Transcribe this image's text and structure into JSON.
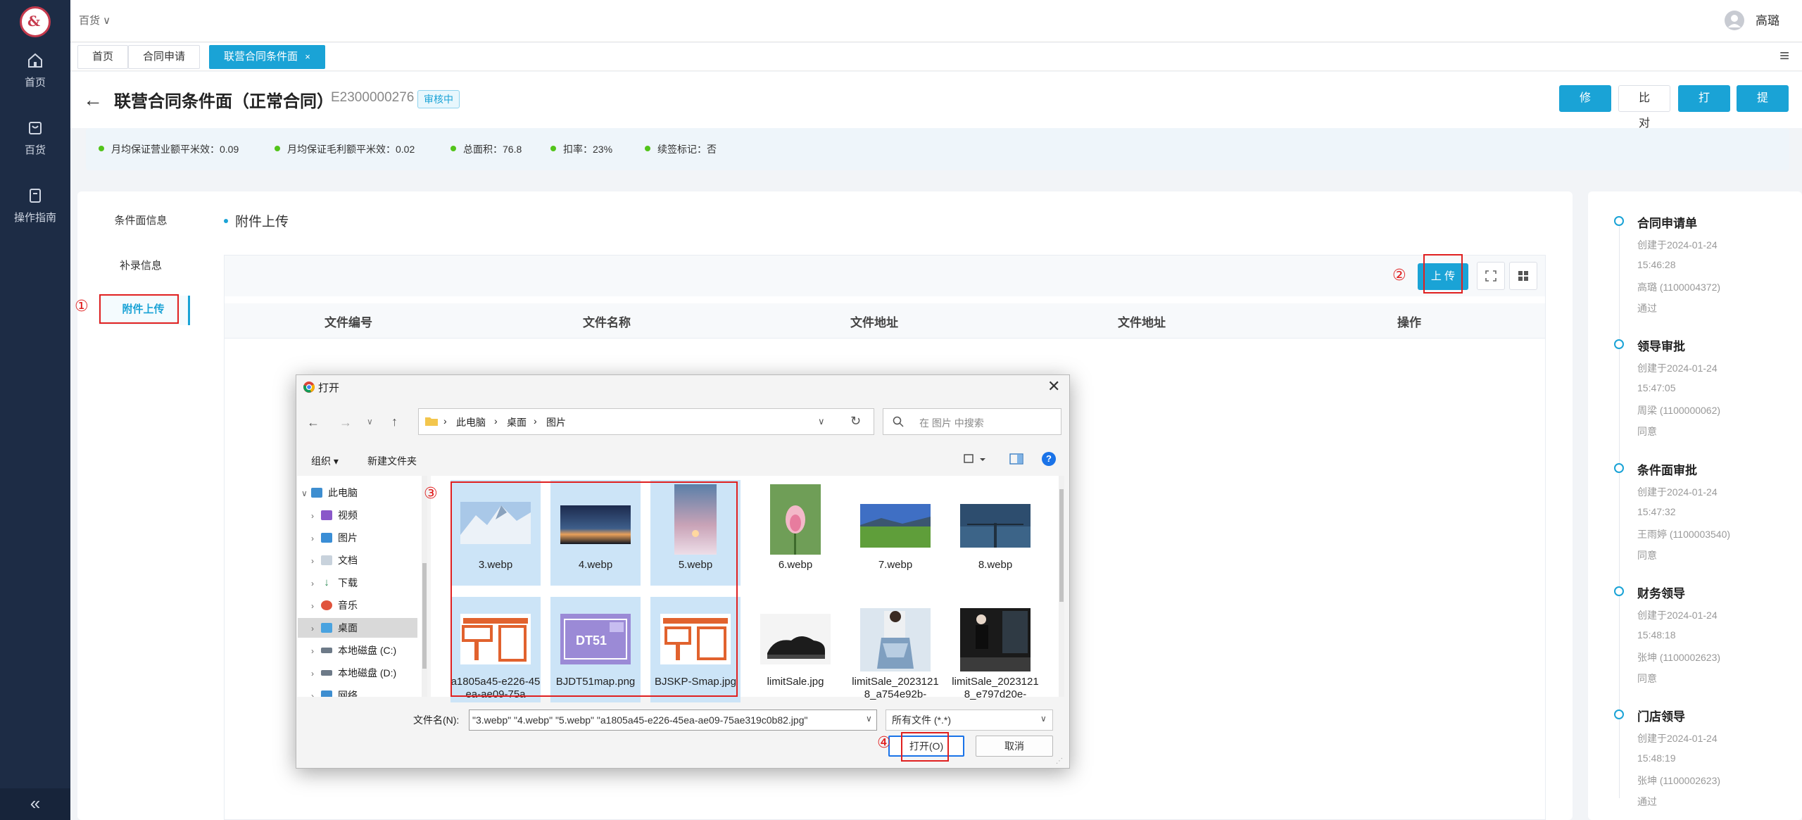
{
  "header": {
    "store": "百货 ∨",
    "user": "高璐"
  },
  "sidebar": {
    "items": [
      {
        "label": "首页",
        "icon": "home-icon"
      },
      {
        "label": "百货",
        "icon": "store-icon"
      },
      {
        "label": "操作指南",
        "icon": "guide-icon"
      }
    ],
    "collapse": "«"
  },
  "tabs": [
    {
      "label": "首页"
    },
    {
      "label": "合同申请"
    },
    {
      "label": "联营合同条件面",
      "close": "×"
    }
  ],
  "page": {
    "back": "←",
    "title": "联营合同条件面（正常合同）",
    "code": "E2300000276",
    "status": "审核中"
  },
  "actions": {
    "edit": "修 改",
    "compare": "比 对",
    "print": "打 印",
    "submit": "提 交"
  },
  "stats": [
    "月均保证营业额平米效：0.09",
    "月均保证毛利额平米效：0.02",
    "总面积：76.8",
    "扣率：23%",
    "续签标记：否"
  ],
  "subnav": [
    "条件面信息",
    "补录信息",
    "附件上传"
  ],
  "section": {
    "title": "附件上传",
    "upload": "上 传"
  },
  "table": {
    "columns": [
      "文件编号",
      "文件名称",
      "文件地址",
      "文件地址",
      "操作"
    ]
  },
  "timeline": [
    {
      "title": "合同申请单",
      "created": "创建于2024-01-24",
      "time": "15:46:28",
      "person": "高璐 (1100004372)",
      "result": "通过"
    },
    {
      "title": "领导审批",
      "created": "创建于2024-01-24",
      "time": "15:47:05",
      "person": "周梁 (1100000062)",
      "result": "同意"
    },
    {
      "title": "条件面审批",
      "created": "创建于2024-01-24",
      "time": "15:47:32",
      "person": "王雨婷 (1100003540)",
      "result": "同意"
    },
    {
      "title": "财务领导",
      "created": "创建于2024-01-24",
      "time": "15:48:18",
      "person": "张坤 (1100002623)",
      "result": "同意"
    },
    {
      "title": "门店领导",
      "created": "创建于2024-01-24",
      "time": "15:48:19",
      "person": "张坤 (1100002623)",
      "result": "通过"
    }
  ],
  "annotations": [
    "①",
    "②",
    "③",
    "④"
  ],
  "dialog": {
    "title": "打开",
    "close": "✕",
    "breadcrumb": [
      "此电脑",
      "桌面",
      "图片"
    ],
    "search_placeholder": "在 图片 中搜索",
    "organize": "组织 ▾",
    "new_folder": "新建文件夹",
    "tree": [
      "此电脑",
      "视频",
      "图片",
      "文档",
      "下载",
      "音乐",
      "桌面",
      "本地磁盘 (C:)",
      "本地磁盘 (D:)",
      "网络"
    ],
    "files": [
      {
        "name": "3.webp",
        "selected": true,
        "thumb": "snow-mountain"
      },
      {
        "name": "4.webp",
        "selected": true,
        "thumb": "sunset"
      },
      {
        "name": "5.webp",
        "selected": true,
        "thumb": "winter-tall"
      },
      {
        "name": "6.webp",
        "selected": false,
        "thumb": "lotus"
      },
      {
        "name": "7.webp",
        "selected": false,
        "thumb": "meadow"
      },
      {
        "name": "8.webp",
        "selected": false,
        "thumb": "pier"
      },
      {
        "name": "a1805a45-e226-45ea-ae09-75a",
        "selected": true,
        "thumb": "orange-map"
      },
      {
        "name": "BJDT51map.png",
        "selected": true,
        "thumb": "purple-map"
      },
      {
        "name": "BJSKP-Smap.jpg",
        "selected": true,
        "thumb": "orange-map"
      },
      {
        "name": "limitSale.jpg",
        "selected": false,
        "thumb": "shoe"
      },
      {
        "name": "limitSale_20231218_a754e92b-",
        "selected": false,
        "thumb": "fashion"
      },
      {
        "name": "limitSale_20231218_e797d20e-",
        "selected": false,
        "thumb": "dark-room"
      }
    ],
    "filename_label": "文件名(N):",
    "filename_value": "\"3.webp\" \"4.webp\" \"5.webp\" \"a1805a45-e226-45ea-ae09-75ae319c0b82.jpg\"",
    "filetype": "所有文件 (*.*)",
    "open": "打开(O)",
    "cancel": "取消"
  },
  "colors": {
    "accent": "#1aa3d6",
    "sidebar": "#1d2c45",
    "annotation": "#e02020"
  }
}
